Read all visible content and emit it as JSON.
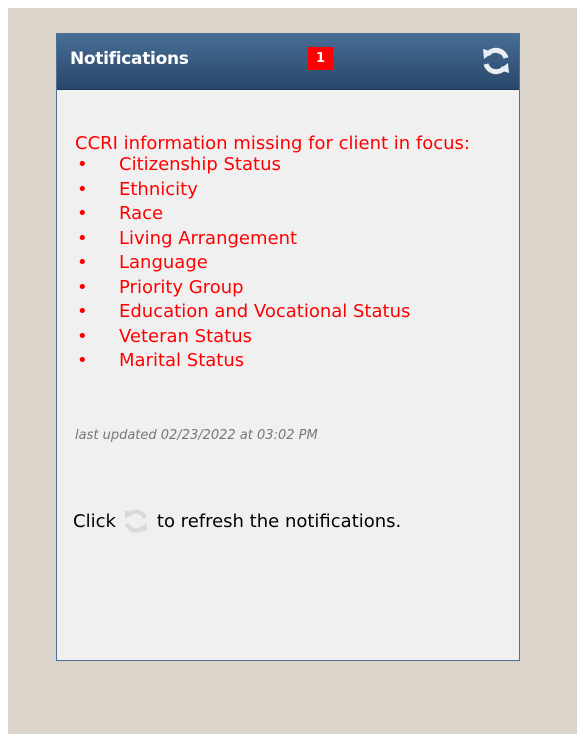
{
  "panel": {
    "title": "Notifications",
    "badge_count": "1",
    "refresh_icon": "refresh-icon",
    "colors": {
      "header_top": "#496d95",
      "header_bottom": "#27476a",
      "badge": "#ff0000",
      "alert_text": "#ff0000",
      "panel_bg": "#f0f0f0",
      "page_bg": "#dcd5cc"
    }
  },
  "notification": {
    "heading": "CCRI information missing for client in focus:",
    "missing_items": [
      "Citizenship Status",
      "Ethnicity",
      "Race",
      "Living Arrangement",
      "Language",
      "Priority Group",
      "Education and Vocational Status",
      "Veteran Status",
      "Marital Status"
    ],
    "bullet": "•",
    "last_updated": "last updated 02/23/2022 at 03:02 PM"
  },
  "hint": {
    "before": "Click",
    "after": "to refresh the notifications.",
    "icon": "refresh-icon"
  }
}
